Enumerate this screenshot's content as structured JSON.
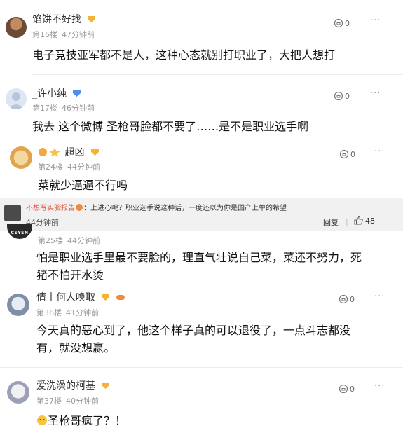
{
  "comments": [
    {
      "username": "馅饼不好找",
      "floor": "第16楼",
      "time": "47分钟前",
      "likes": "0",
      "text_lines": [
        "电子竞技亚军都不是人，这种心态就别打职业了，大把人想打"
      ]
    },
    {
      "username": "_许小纯",
      "floor": "第17楼",
      "time": "46分钟前",
      "likes": "0",
      "text_lines": [
        "我去 这个微博 圣枪哥脸都不要了……是不是职业选手啊"
      ]
    },
    {
      "username": "超凶",
      "floor": "第24楼",
      "time": "44分钟前",
      "likes": "0",
      "text_lines": [
        "菜就少逼逼不行吗"
      ]
    },
    {
      "username": "",
      "floor": "第25楼",
      "time": "44分钟前",
      "likes": "",
      "text_lines": [
        "怕是职业选手里最不要脸的，理直气壮说自己菜，菜还不努力，死",
        "猪不怕开水烫"
      ]
    },
    {
      "username": "倩丨何人唤取",
      "floor": "第36楼",
      "time": "41分钟前",
      "likes": "0",
      "text_lines": [
        "今天真的恶心到了，他这个样子真的可以退役了，一点斗志都没",
        "有，就没想赢。"
      ]
    },
    {
      "username": "爱洗澡的柯基",
      "floor": "第37楼",
      "time": "40分钟前",
      "likes": "0",
      "text_lines": [
        "圣枪哥疯了？！"
      ]
    }
  ],
  "reply_overlay": {
    "user": "不想写实验报告",
    "text": "：上进心呢？职业选手说这种话，一度还以为你是国产上单的希望",
    "time": "44分钟前",
    "reply_label": "回复",
    "likes": "48"
  },
  "avatar_text": "CSYSN",
  "more_glyph": "···",
  "colors": {
    "vip_gold": "#f5b335",
    "vip_blue": "#4f8df5",
    "reply_user": "#e0533f"
  }
}
